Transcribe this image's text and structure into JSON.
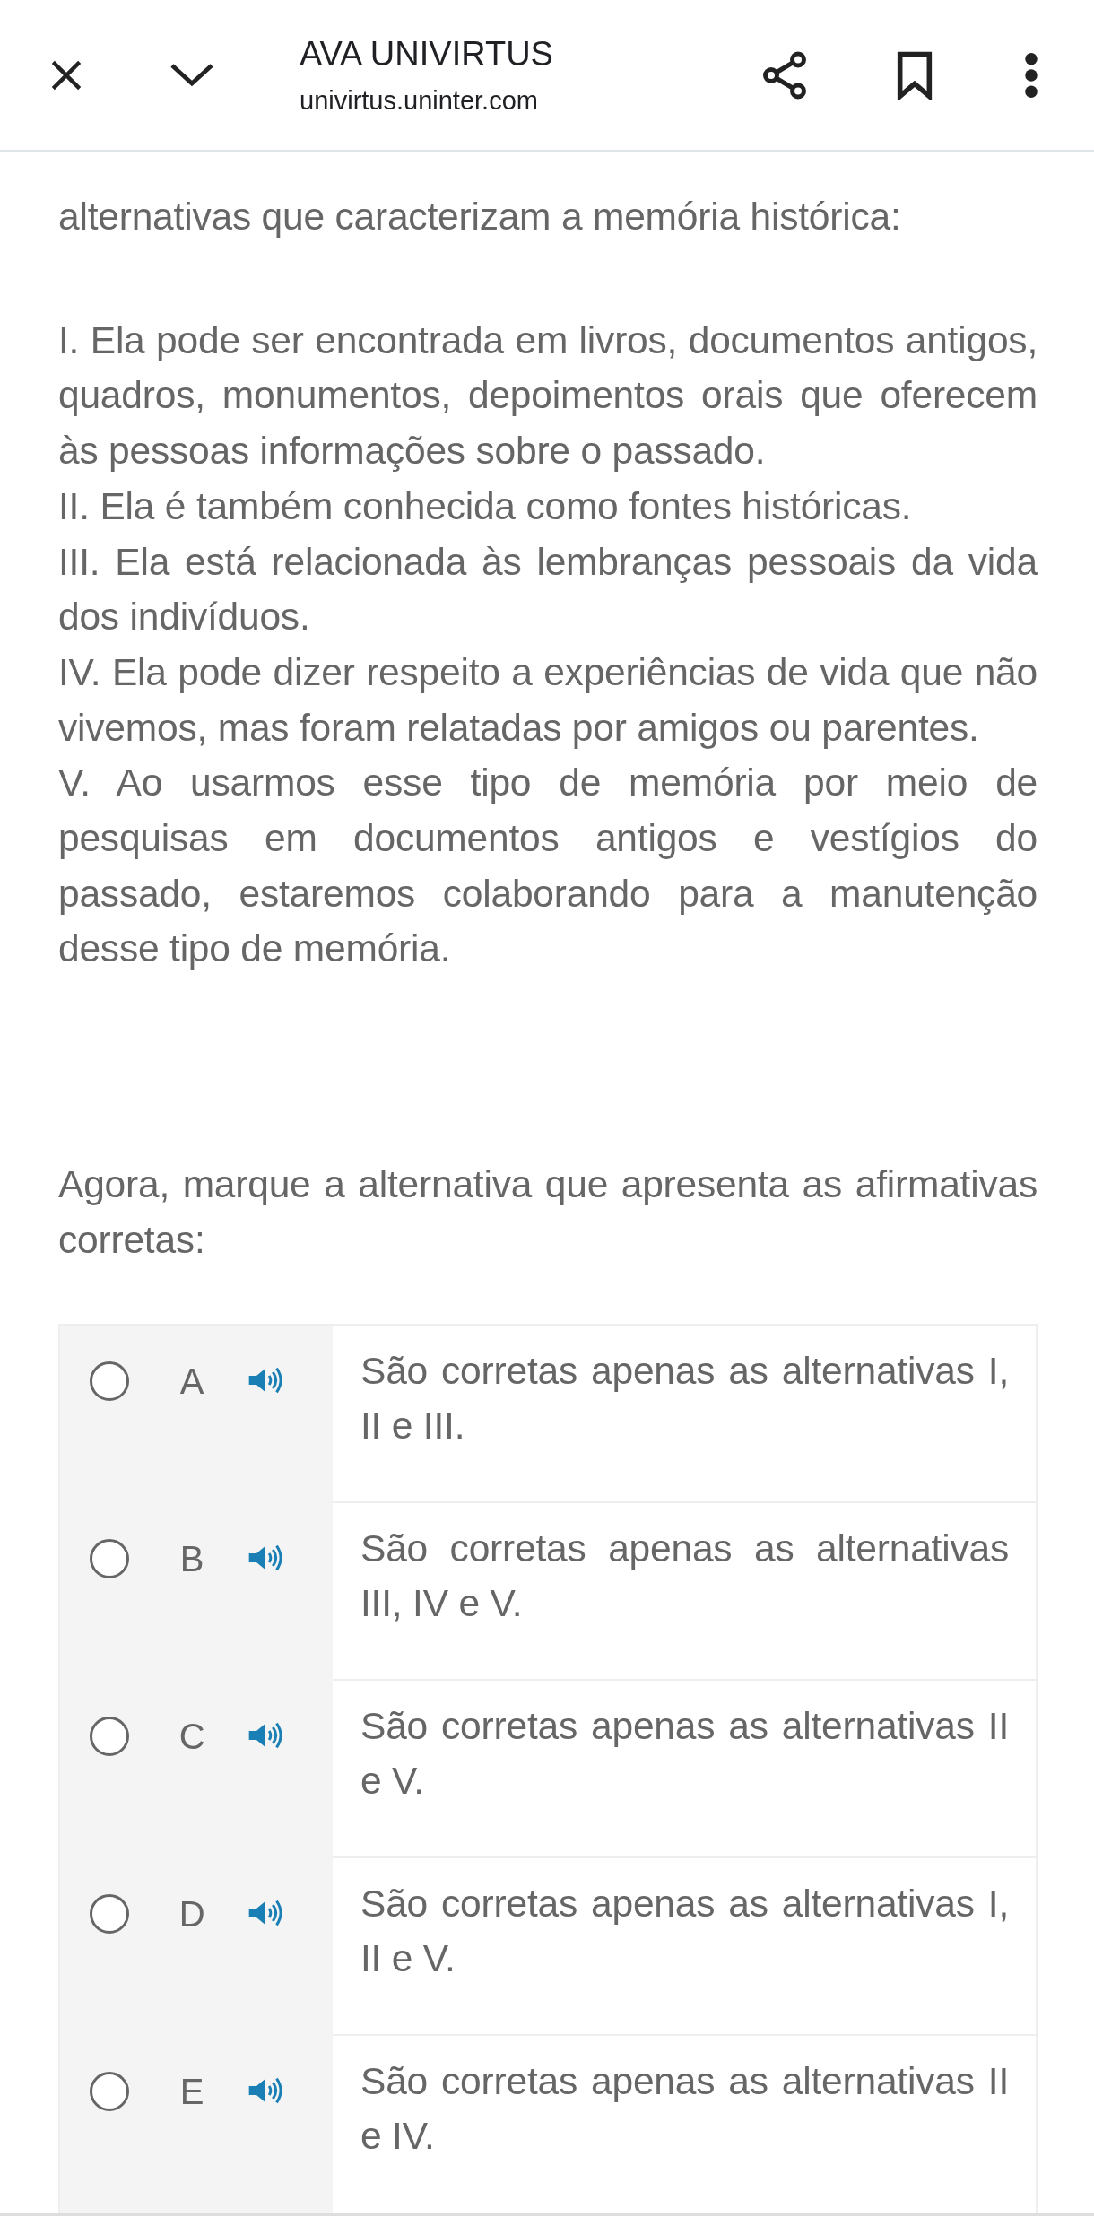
{
  "browser_bar": {
    "title": "AVA UNIVIRTUS",
    "url": "univirtus.uninter.com"
  },
  "question": {
    "intro": "alternativas que caracterizam a memória histórica:",
    "statements": [
      "I. Ela pode ser encontrada em livros, documentos antigos, quadros, monumentos, depoimentos orais que oferecem às pessoas informações sobre o passado.",
      "II. Ela é também conhecida como fontes históricas.",
      "III. Ela está relacionada às lembranças pessoais da vida dos indivíduos.",
      "IV. Ela pode dizer respeito a experiências de vida que não vivemos, mas foram relatadas por amigos ou parentes.",
      "V. Ao usarmos esse tipo de memória por meio de pesquisas em documentos antigos e vestígios do passado, estaremos colaborando para a manutenção desse tipo de memória."
    ],
    "prompt": "Agora, marque a alternativa que apresenta as afirmativas corretas:"
  },
  "options": [
    {
      "letter": "A",
      "text": "São corretas apenas as alternativas I, II e III.",
      "selected": false
    },
    {
      "letter": "B",
      "text": "São corretas apenas as alternativas III, IV e V.",
      "selected": false
    },
    {
      "letter": "C",
      "text": "São corretas apenas as alternativas II e V.",
      "selected": false
    },
    {
      "letter": "D",
      "text": "São corretas apenas as alternativas I, II e V.",
      "selected": false
    },
    {
      "letter": "E",
      "text": "São corretas apenas as alternativas II e IV.",
      "selected": false
    }
  ]
}
